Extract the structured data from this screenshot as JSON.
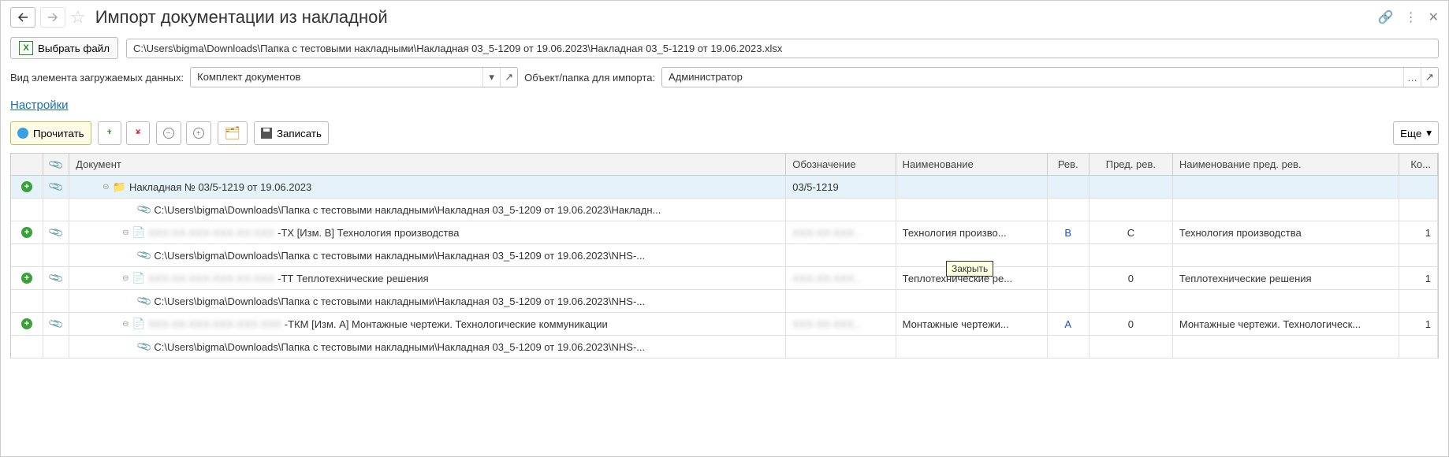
{
  "header": {
    "title": "Импорт документации из накладной"
  },
  "filebar": {
    "button_label": "Выбрать файл",
    "path": "C:\\Users\\bigma\\Downloads\\Папка с тестовыми накладными\\Накладная 03_5-1209 от 19.06.2023\\Накладная 03_5-1219 от 19.06.2023.xlsx"
  },
  "params": {
    "view_label": "Вид элемента загружаемых данных:",
    "view_value": "Комплект документов",
    "dest_label": "Объект/папка для импорта:",
    "dest_value": "Администратор"
  },
  "settings_link": "Настройки",
  "toolbar": {
    "read_label": "Прочитать",
    "save_label": "Записать",
    "more_label": "Еще"
  },
  "tooltip": "Закрыть",
  "columns": {
    "status": "",
    "attach": "",
    "doc": "Документ",
    "desig": "Обозначение",
    "name": "Наименование",
    "rev": "Рев.",
    "prev": "Пред. рев.",
    "prevname": "Наименование пред. рев.",
    "qty": "Ко..."
  },
  "rows": [
    {
      "type": "folder",
      "status": "plus",
      "attach": true,
      "selected": true,
      "doc": "Накладная № 03/5-1219 от 19.06.2023",
      "desig": "03/5-1219",
      "name": "",
      "rev": "",
      "prev": "",
      "prevname": "",
      "qty": ""
    },
    {
      "type": "file",
      "doc": "C:\\Users\\bigma\\Downloads\\Папка с тестовыми накладными\\Накладная 03_5-1209 от 19.06.2023\\Накладн..."
    },
    {
      "type": "item",
      "status": "plus",
      "attach": true,
      "blurred_prefix": "XXX-XX-XXX-XXX-XX-XXX",
      "doc": "-ТХ [Изм. B] Технология производства",
      "desig_blur": "XXX-XX-XXX...",
      "name": "Технология произво...",
      "rev": "B",
      "prev": "C",
      "prevname": "Технология производства",
      "qty": "1"
    },
    {
      "type": "file",
      "doc": "C:\\Users\\bigma\\Downloads\\Папка с тестовыми накладными\\Накладная 03_5-1209 от 19.06.2023\\NHS-..."
    },
    {
      "type": "item",
      "status": "plus",
      "attach": true,
      "blurred_prefix": "XXX-XX-XXX-XXX-XX-XXX",
      "doc": "-ТТ Теплотехнические решения",
      "desig_blur": "XXX-XX-XXX...",
      "name": "Теплотехнические ре...",
      "rev": "",
      "prev": "0",
      "prevname": "Теплотехнические решения",
      "qty": "1"
    },
    {
      "type": "file",
      "doc": "C:\\Users\\bigma\\Downloads\\Папка с тестовыми накладными\\Накладная 03_5-1209 от 19.06.2023\\NHS-..."
    },
    {
      "type": "item",
      "status": "plus",
      "attach": true,
      "blurred_prefix": "XXX-XX-XXX-XXX-XXX-XXX",
      "doc": "-ТКМ [Изм. A] Монтажные чертежи. Технологические коммуникации",
      "desig_blur": "XXX-XX-XXX...",
      "name": "Монтажные чертежи...",
      "rev": "A",
      "prev": "0",
      "prevname": "Монтажные чертежи. Технологическ...",
      "qty": "1"
    },
    {
      "type": "file",
      "doc": "C:\\Users\\bigma\\Downloads\\Папка с тестовыми накладными\\Накладная 03_5-1209 от 19.06.2023\\NHS-..."
    }
  ]
}
